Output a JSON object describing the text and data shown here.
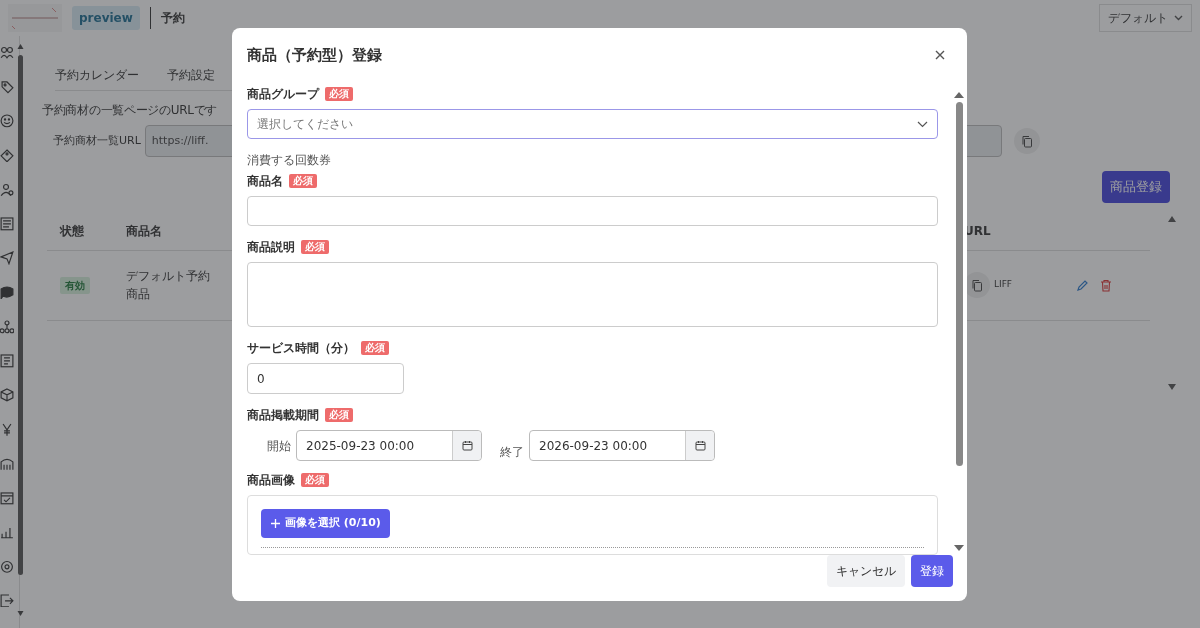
{
  "top_bar": {
    "badge": "preview",
    "page_title": "予約",
    "account_menu": "デフォルト"
  },
  "tabs": [
    {
      "label": "予約カレンダー"
    },
    {
      "label": "予約設定"
    }
  ],
  "url_section": {
    "note": "予約商材の一覧ページのURLです",
    "label": "予約商材一覧URL",
    "value": "https://liff."
  },
  "register_button": "商品登録",
  "table": {
    "columns": [
      "状態",
      "商品名",
      "URL"
    ],
    "rows": [
      {
        "status": "有効",
        "name": "デフォルト予約商品",
        "url_button": "LIFF"
      }
    ]
  },
  "modal": {
    "title": "商品（予約型）登録",
    "fields": [
      {
        "kind": "select",
        "label": "商品グループ",
        "badge": "必須",
        "placeholder": "選択してください"
      },
      {
        "kind": "note",
        "text": "消費する回数券"
      },
      {
        "kind": "text",
        "label": "商品名",
        "badge": "必須"
      },
      {
        "kind": "textarea",
        "label": "商品説明",
        "badge": "必須"
      },
      {
        "kind": "number",
        "label": "サービス時間（分）",
        "badge": "必須",
        "value": "0"
      },
      {
        "kind": "daterange",
        "label": "商品掲載期間",
        "badge": "必須",
        "start_label": "開始",
        "start": "2025-09-23 00:00",
        "end_label": "終了",
        "end": "2026-09-23 00:00"
      },
      {
        "kind": "image",
        "label": "商品画像",
        "badge": "必須",
        "button": "画像を選択 (0/10)"
      }
    ],
    "buttons": [
      {
        "kind": "secondary",
        "label": "キャンセル"
      },
      {
        "kind": "primary",
        "label": "登録"
      }
    ]
  }
}
